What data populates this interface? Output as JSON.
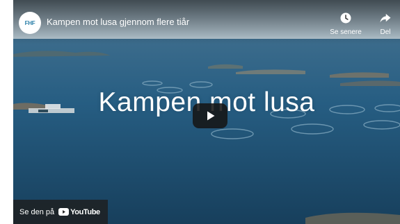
{
  "channel": {
    "logo_text": "FHF",
    "logo_color": "#2a7fa8"
  },
  "video": {
    "title": "Kampen mot lusa gjennom flere tiår",
    "overlay_title": "Kampen mot lusa"
  },
  "actions": {
    "watch_later": {
      "label": "Se senere",
      "icon": "clock-icon"
    },
    "share": {
      "label": "Del",
      "icon": "share-arrow-icon"
    }
  },
  "player": {
    "play_icon": "play-icon",
    "watch_on_label": "Se den på",
    "youtube_wordmark": "YouTube"
  },
  "colors": {
    "sea": "#1e4f73",
    "sky": "#b4c7d2",
    "overlay": "#1e1e1e"
  }
}
